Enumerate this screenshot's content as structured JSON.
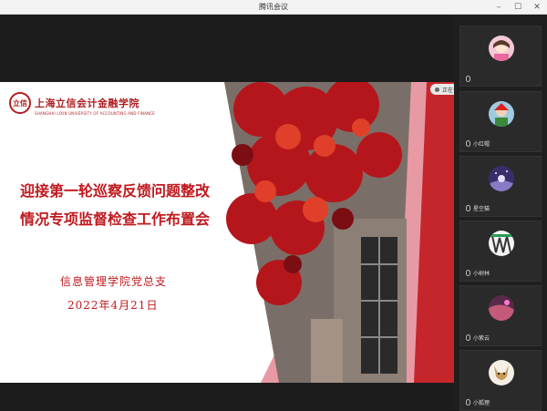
{
  "window": {
    "title": "腾讯会议"
  },
  "slide": {
    "logo_seal": "立信",
    "logo_name": "上海立信会计金融学院",
    "logo_sub": "SHANGHAI LIXIN UNIVERSITY OF ACCOUNTING AND FINANCE",
    "headline_line1": "迎接第一轮巡察反馈问题整改",
    "headline_line2": "情况专项监督检查工作布置会",
    "org": "信息管理学院党总支",
    "date": "2022年4月21日"
  },
  "speaker_chip": {
    "label": "正在讲话：信息管理学院"
  },
  "participants": [
    {
      "name": ""
    },
    {
      "name": "小红帽"
    },
    {
      "name": "星空猫"
    },
    {
      "name": "小树林"
    },
    {
      "name": "小紫云"
    },
    {
      "name": "小狐狸"
    }
  ],
  "colors": {
    "brand_red": "#c0181e",
    "sidebar_bg": "#1f1f1f"
  }
}
